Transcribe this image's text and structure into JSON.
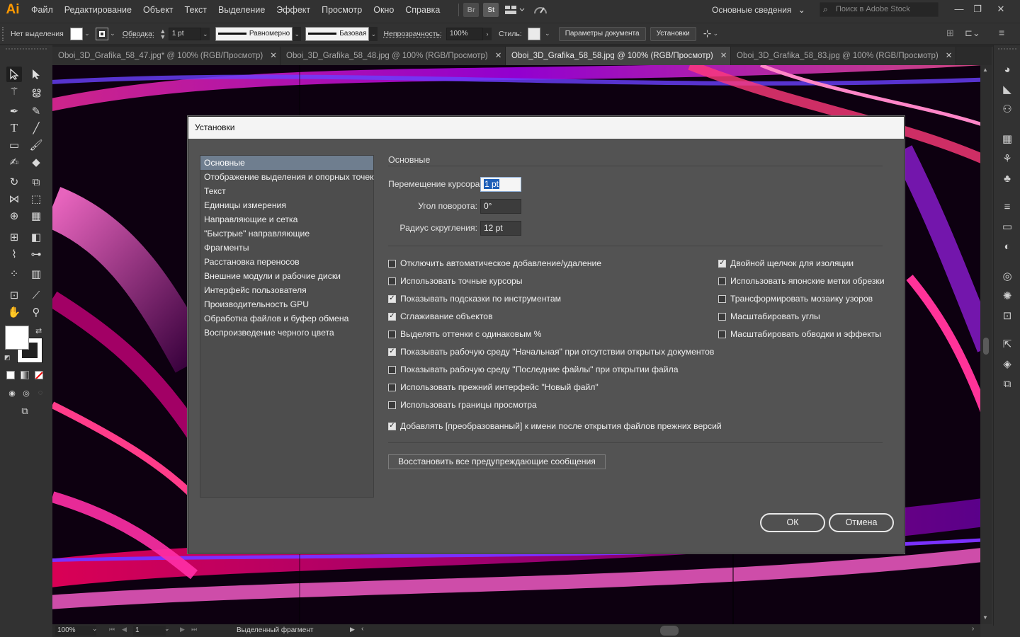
{
  "app": {
    "logo": "Ai"
  },
  "menu": [
    "Файл",
    "Редактирование",
    "Объект",
    "Текст",
    "Выделение",
    "Эффект",
    "Просмотр",
    "Окно",
    "Справка"
  ],
  "menubar_buttons": {
    "bridge": "Br",
    "stock": "St"
  },
  "workspace": "Основные сведения",
  "stock_search_placeholder": "Поиск в Adobe Stock",
  "control": {
    "selection": "Нет выделения",
    "stroke_label": "Обводка:",
    "stroke_value": "1 pt",
    "profile_1": "Равномерно",
    "profile_2": "Базовая",
    "opacity_label": "Непрозрачность:",
    "opacity_value": "100%",
    "style_label": "Стиль:",
    "doc_params_button": "Параметры документа",
    "prefs_button": "Установки"
  },
  "tabs": [
    {
      "label": "Oboi_3D_Grafika_58_47.jpg* @ 100% (RGB/Просмотр)",
      "active": false
    },
    {
      "label": "Oboi_3D_Grafika_58_48.jpg @ 100% (RGB/Просмотр)",
      "active": false
    },
    {
      "label": "Oboi_3D_Grafika_58_58.jpg @ 100% (RGB/Просмотр)",
      "active": true
    },
    {
      "label": "Oboi_3D_Grafika_58_83.jpg @ 100% (RGB/Просмотр)",
      "active": false
    }
  ],
  "status": {
    "zoom": "100%",
    "artboard": "1",
    "info": "Выделенный фрагмент"
  },
  "dialog": {
    "title": "Установки",
    "nav": [
      "Основные",
      "Отображение выделения и опорных точек",
      "Текст",
      "Единицы измерения",
      "Направляющие и сетка",
      "\"Быстрые\" направляющие",
      "Фрагменты",
      "Расстановка переносов",
      "Внешние модули и рабочие диски",
      "Интерфейс пользователя",
      "Производительность GPU",
      "Обработка файлов и буфер обмена",
      "Воспроизведение черного цвета"
    ],
    "nav_active_index": 0,
    "section_title": "Основные",
    "fields": {
      "cursor_key_label": "Перемещение курсора:",
      "cursor_key_value": "1 pt",
      "rotate_label": "Угол поворота:",
      "rotate_value": "0°",
      "corner_label": "Радиус скругления:",
      "corner_value": "12 pt"
    },
    "checkboxes_left": [
      {
        "label": "Отключить автоматическое добавление/удаление",
        "checked": false
      },
      {
        "label": "Использовать точные курсоры",
        "checked": false
      },
      {
        "label": "Показывать подсказки по инструментам",
        "checked": true
      },
      {
        "label": "Сглаживание объектов",
        "checked": true
      },
      {
        "label": "Выделять оттенки с одинаковым %",
        "checked": false
      },
      {
        "label": "Показывать рабочую среду \"Начальная\" при отсутствии открытых документов",
        "checked": true
      },
      {
        "label": "Показывать рабочую среду \"Последние файлы\" при открытии файла",
        "checked": false
      },
      {
        "label": "Использовать прежний интерфейс \"Новый файл\"",
        "checked": false
      },
      {
        "label": "Использовать границы просмотра",
        "checked": false
      },
      {
        "label": "Добавлять [преобразованный] к имени после открытия файлов прежних версий",
        "checked": true
      }
    ],
    "checkboxes_right": [
      {
        "label": "Двойной щелчок для изоляции",
        "checked": true
      },
      {
        "label": "Использовать японские метки обрезки",
        "checked": false
      },
      {
        "label": "Трансформировать мозаику узоров",
        "checked": false
      },
      {
        "label": "Масштабировать углы",
        "checked": false
      },
      {
        "label": "Масштабировать обводки и эффекты",
        "checked": false
      }
    ],
    "restore_button": "Восстановить все предупреждающие сообщения",
    "ok_button": "ОК",
    "cancel_button": "Отмена"
  },
  "colors": {
    "accent": "#ff9a00",
    "dialog_bg": "#535353",
    "nav_selected": "#6f7e8f"
  }
}
